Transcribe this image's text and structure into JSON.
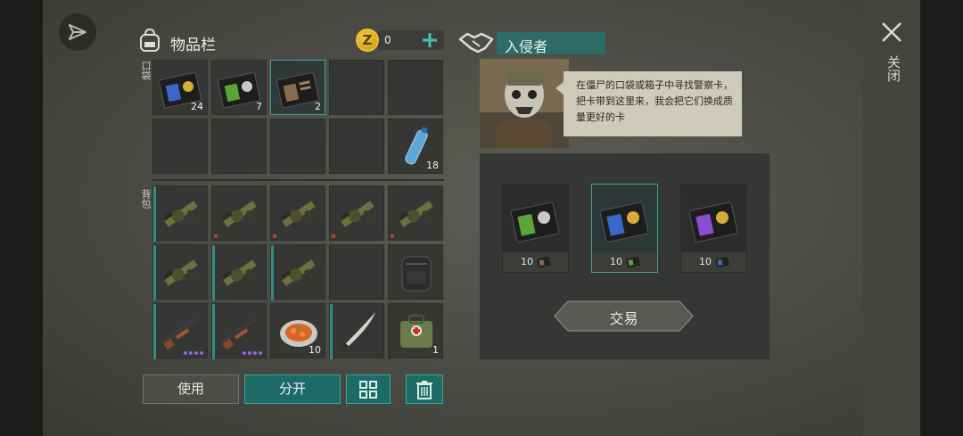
{
  "close_label": "关闭",
  "inventory": {
    "title": "物品栏",
    "coins": "0",
    "pocket_label": "口袋",
    "backpack_label": "背包",
    "pocket_slots": [
      {
        "item": "police-card-blue",
        "count": "24"
      },
      {
        "item": "police-card-green",
        "count": "7"
      },
      {
        "item": "police-card-brown",
        "count": "2"
      },
      {
        "item": "",
        "count": ""
      },
      {
        "item": "",
        "count": ""
      },
      {
        "item": "",
        "count": ""
      },
      {
        "item": "",
        "count": ""
      },
      {
        "item": "",
        "count": ""
      },
      {
        "item": "",
        "count": ""
      },
      {
        "item": "water-bottle",
        "count": "18"
      }
    ],
    "backpack_slots": [
      {
        "item": "grenade-launcher",
        "count": ""
      },
      {
        "item": "grenade-launcher",
        "count": ""
      },
      {
        "item": "grenade-launcher",
        "count": ""
      },
      {
        "item": "grenade-launcher",
        "count": ""
      },
      {
        "item": "grenade-launcher",
        "count": ""
      },
      {
        "item": "grenade-launcher",
        "count": ""
      },
      {
        "item": "grenade-launcher",
        "count": ""
      },
      {
        "item": "grenade-launcher",
        "count": ""
      },
      {
        "item": "",
        "count": ""
      },
      {
        "item": "tactical-backpack",
        "count": ""
      },
      {
        "item": "shotgun",
        "count": ""
      },
      {
        "item": "shotgun",
        "count": ""
      },
      {
        "item": "food-plate",
        "count": "10"
      },
      {
        "item": "machete",
        "count": ""
      },
      {
        "item": "medical-bag",
        "count": "1"
      }
    ],
    "buttons": {
      "use": "使用",
      "split": "分开"
    }
  },
  "trader": {
    "name": "入侵者",
    "dialog": "在僵尸的口袋或箱子中寻找警察卡，把卡带到这里来，我会把它们换成质量更好的卡",
    "offers": [
      {
        "card": "police-card-green",
        "price": "10",
        "cost_card": "police-card-brown"
      },
      {
        "card": "police-card-blue",
        "price": "10",
        "cost_card": "police-card-green"
      },
      {
        "card": "police-card-purple",
        "price": "10",
        "cost_card": "police-card-blue"
      }
    ],
    "trade_label": "交易"
  },
  "colors": {
    "accent_teal": "#1e6a65",
    "selected_border": "#3ca49b",
    "coin_gold": "#f0c030",
    "rarity_purple": "#9a62e0",
    "damage_red": "#c8352d"
  }
}
